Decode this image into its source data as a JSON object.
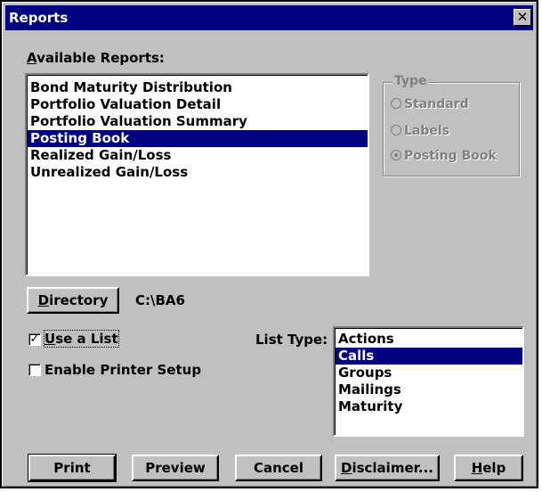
{
  "window": {
    "title": "Reports",
    "close_glyph": "✕"
  },
  "available_reports": {
    "label_accel": "A",
    "label_rest": "vailable Reports:",
    "items": [
      "Bond Maturity Distribution",
      "Portfolio Valuation Detail",
      "Portfolio Valuation Summary",
      "Posting Book",
      "Realized Gain/Loss",
      "Unrealized Gain/Loss"
    ],
    "selected": "Posting Book"
  },
  "type_group": {
    "title": "Type",
    "options": [
      "Standard",
      "Labels",
      "Posting Book"
    ],
    "selected": "Posting Book"
  },
  "directory": {
    "button_accel": "D",
    "button_rest": "irectory",
    "path": "C:\\BA6"
  },
  "use_list": {
    "accel": "U",
    "rest": "se a List",
    "checked": true,
    "check_glyph": "✓"
  },
  "printer_setup": {
    "label": "Enable Printer Setup",
    "checked": false
  },
  "list_type": {
    "label": "List Type:",
    "items": [
      "Actions",
      "Calls",
      "Groups",
      "Mailings",
      "Maturity"
    ],
    "selected": "Calls"
  },
  "buttons": {
    "print": "Print",
    "preview": "Preview",
    "cancel": "Cancel",
    "disclaimer_accel": "D",
    "disclaimer_rest": "isclaimer...",
    "help_accel": "H",
    "help_rest": "elp"
  }
}
